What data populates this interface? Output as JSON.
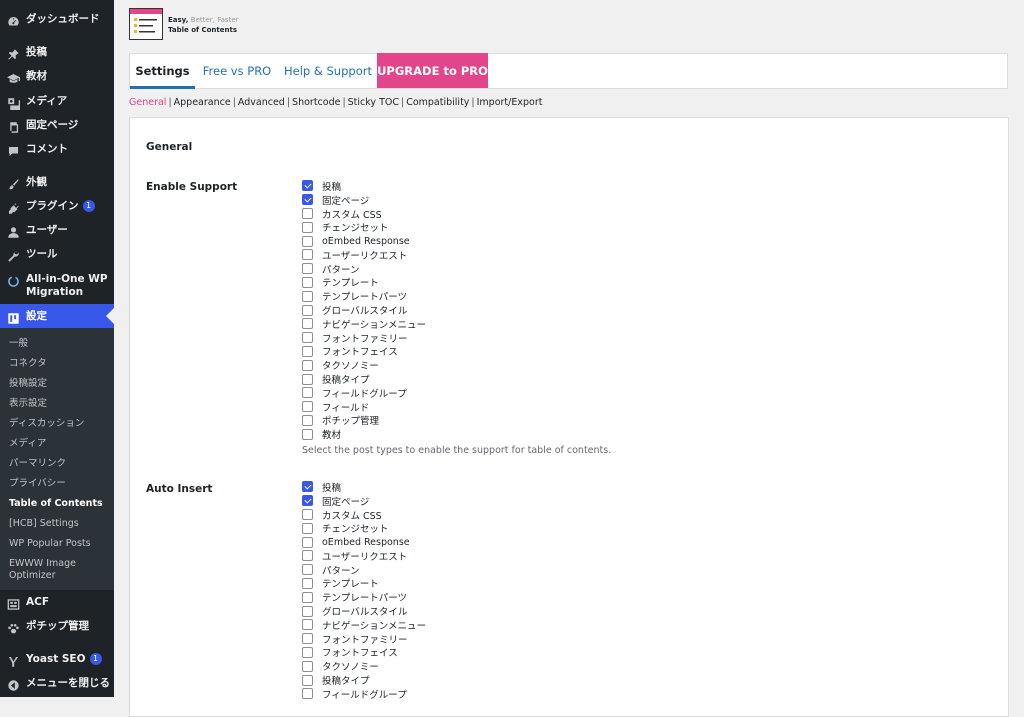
{
  "sidebar": {
    "items": [
      {
        "label": "ダッシュボード",
        "icon": "dashboard-icon"
      },
      {
        "label": "投稿",
        "icon": "pin-icon"
      },
      {
        "label": "教材",
        "icon": "graduation-cap-icon"
      },
      {
        "label": "メディア",
        "icon": "media-icon"
      },
      {
        "label": "固定ページ",
        "icon": "page-icon"
      },
      {
        "label": "コメント",
        "icon": "comment-icon"
      },
      {
        "label": "外観",
        "icon": "brush-icon"
      },
      {
        "label": "プラグイン",
        "icon": "plugin-icon",
        "badge": "1"
      },
      {
        "label": "ユーザー",
        "icon": "user-icon"
      },
      {
        "label": "ツール",
        "icon": "wrench-icon"
      },
      {
        "label": "All-in-One WP Migration",
        "icon": "migration-icon"
      },
      {
        "label": "設定",
        "icon": "settings-icon",
        "active": true
      },
      {
        "label": "ACF",
        "icon": "acf-icon"
      },
      {
        "label": "ポチップ管理",
        "icon": "paw-icon"
      },
      {
        "label": "Yoast SEO",
        "icon": "yoast-icon",
        "badge": "1"
      },
      {
        "label": "メニューを閉じる",
        "icon": "collapse-icon"
      }
    ],
    "submenu": [
      "一般",
      "コネクタ",
      "投稿設定",
      "表示設定",
      "ディスカッション",
      "メディア",
      "パーマリンク",
      "プライバシー",
      "Table of Contents",
      "[HCB] Settings",
      "WP Popular Posts",
      "EWWW Image Optimizer"
    ],
    "submenu_current": "Table of Contents"
  },
  "header": {
    "logo_line1_a": "Easy,",
    "logo_line1_b": "Better,",
    "logo_line1_c": "Faster",
    "logo_line2": "Table of Contents"
  },
  "tabs": [
    {
      "label": "Settings",
      "active": true
    },
    {
      "label": "Free vs PRO"
    },
    {
      "label": "Help & Support"
    },
    {
      "label": "UPGRADE to PRO",
      "pro": true
    }
  ],
  "subnav": [
    "General",
    "Appearance",
    "Advanced",
    "Shortcode",
    "Sticky TOC",
    "Compatibility",
    "Import/Export"
  ],
  "subnav_current": "General",
  "general": {
    "section_title": "General",
    "enable_support": {
      "label": "Enable Support",
      "options": [
        {
          "label": "投稿",
          "checked": true
        },
        {
          "label": "固定ページ",
          "checked": true
        },
        {
          "label": "カスタム CSS",
          "checked": false
        },
        {
          "label": "チェンジセット",
          "checked": false
        },
        {
          "label": "oEmbed Response",
          "checked": false
        },
        {
          "label": "ユーザーリクエスト",
          "checked": false
        },
        {
          "label": "パターン",
          "checked": false
        },
        {
          "label": "テンプレート",
          "checked": false
        },
        {
          "label": "テンプレートパーツ",
          "checked": false
        },
        {
          "label": "グローバルスタイル",
          "checked": false
        },
        {
          "label": "ナビゲーションメニュー",
          "checked": false
        },
        {
          "label": "フォントファミリー",
          "checked": false
        },
        {
          "label": "フォントフェイス",
          "checked": false
        },
        {
          "label": "タクソノミー",
          "checked": false
        },
        {
          "label": "投稿タイプ",
          "checked": false
        },
        {
          "label": "フィールドグループ",
          "checked": false
        },
        {
          "label": "フィールド",
          "checked": false
        },
        {
          "label": "ポチップ管理",
          "checked": false
        },
        {
          "label": "教材",
          "checked": false
        }
      ],
      "help": "Select the post types to enable the support for table of contents."
    },
    "auto_insert": {
      "label": "Auto Insert",
      "options": [
        {
          "label": "投稿",
          "checked": true
        },
        {
          "label": "固定ページ",
          "checked": true
        },
        {
          "label": "カスタム CSS",
          "checked": false
        },
        {
          "label": "チェンジセット",
          "checked": false
        },
        {
          "label": "oEmbed Response",
          "checked": false
        },
        {
          "label": "ユーザーリクエスト",
          "checked": false
        },
        {
          "label": "パターン",
          "checked": false
        },
        {
          "label": "テンプレート",
          "checked": false
        },
        {
          "label": "テンプレートパーツ",
          "checked": false
        },
        {
          "label": "グローバルスタイル",
          "checked": false
        },
        {
          "label": "ナビゲーションメニュー",
          "checked": false
        },
        {
          "label": "フォントファミリー",
          "checked": false
        },
        {
          "label": "フォントフェイス",
          "checked": false
        },
        {
          "label": "タクソノミー",
          "checked": false
        },
        {
          "label": "投稿タイプ",
          "checked": false
        },
        {
          "label": "フィールドグループ",
          "checked": false
        }
      ]
    }
  },
  "colors": {
    "accent": "#3858e9",
    "pro": "#e2458a",
    "link": "#2271b1",
    "sidebar": "#1d2327"
  }
}
